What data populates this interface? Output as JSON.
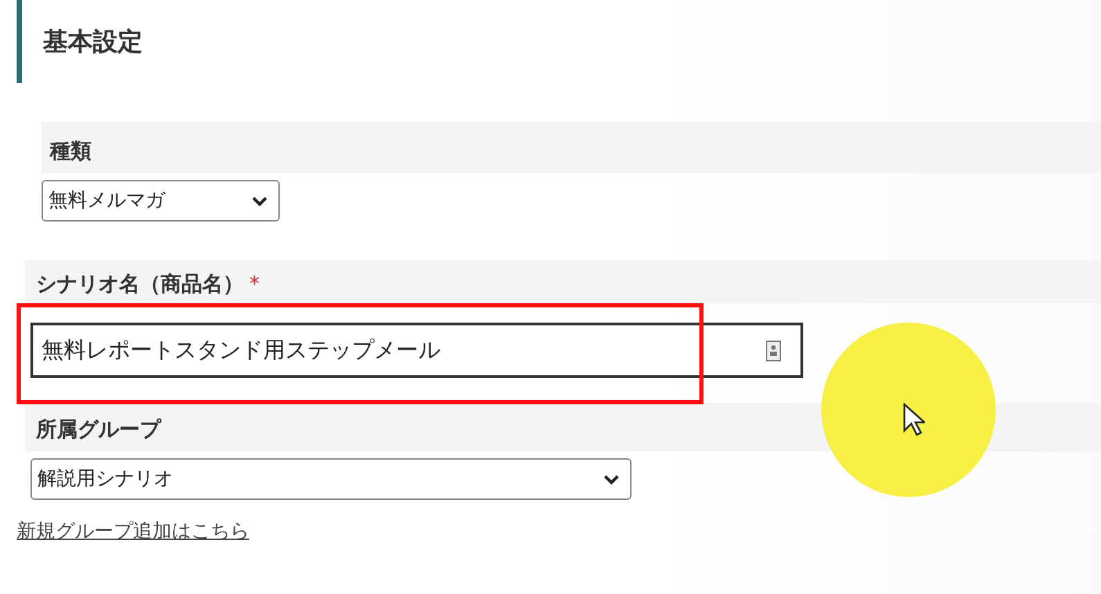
{
  "section_title": "基本設定",
  "fields": [
    {
      "kind": "select",
      "label": "種類",
      "value": "無料メルマガ"
    },
    {
      "kind": "text",
      "label": "シナリオ名（商品名）",
      "required_mark": "*",
      "value": "無料レポートスタンド用ステップメール"
    },
    {
      "kind": "select",
      "label": "所属グループ",
      "value": "解説用シナリオ"
    }
  ],
  "link": "新規グループ追加はこちら"
}
